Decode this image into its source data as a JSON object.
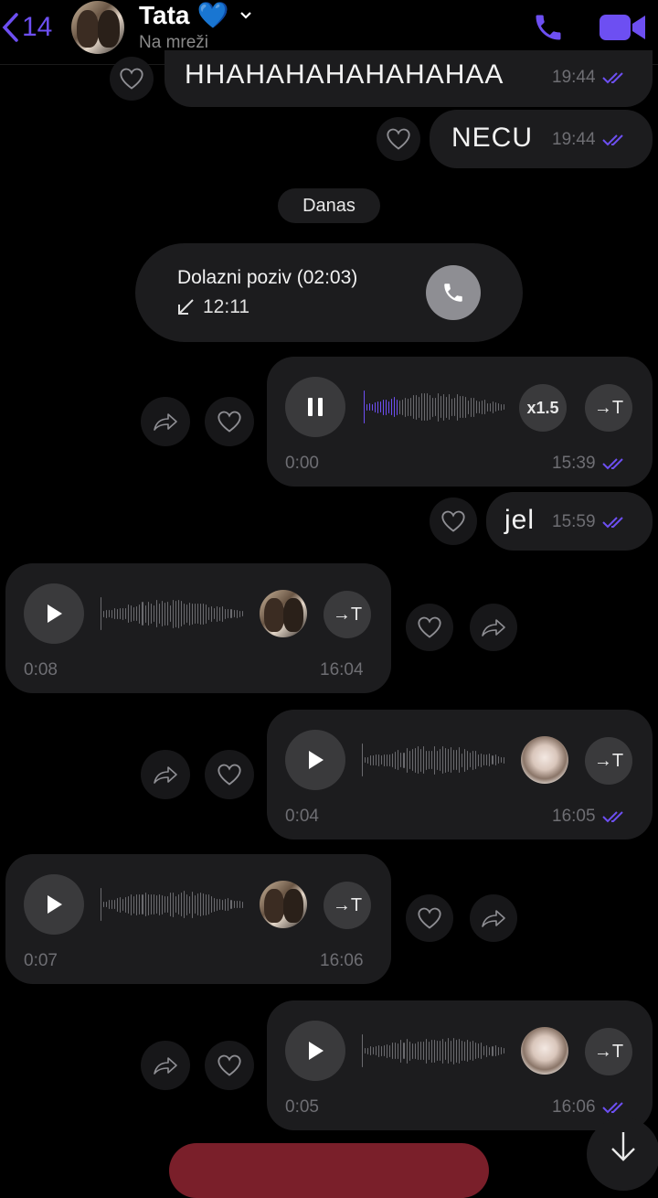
{
  "header": {
    "back_count": "14",
    "contact_name": "Tata",
    "heart_emoji": "💙",
    "status": "Na mreži",
    "accent": "#6d4ff2"
  },
  "messages": {
    "m1": {
      "text": "HHAHAHAHAHAHAHAA",
      "time": "19:44"
    },
    "m2": {
      "text": "NECU",
      "time": "19:44"
    },
    "date_divider": "Danas",
    "call": {
      "title": "Dolazni poziv (02:03)",
      "time": "12:11"
    },
    "voice1": {
      "position": "0:00",
      "time": "15:39",
      "speed": "x1.5",
      "progress": 0.25
    },
    "m3": {
      "text": "jel",
      "time": "15:59"
    },
    "voice2": {
      "duration": "0:08",
      "time": "16:04"
    },
    "voice3": {
      "duration": "0:04",
      "time": "16:05"
    },
    "voice4": {
      "duration": "0:07",
      "time": "16:06"
    },
    "voice5": {
      "duration": "0:05",
      "time": "16:06"
    }
  },
  "transcribe_label": "→T",
  "icons": [
    "chevron-left-icon",
    "phone-icon",
    "video-icon",
    "heart-outline-icon",
    "share-icon",
    "pause-icon",
    "play-icon",
    "transcribe-icon",
    "read-check-icon",
    "incoming-call-icon",
    "arrow-down-icon"
  ]
}
